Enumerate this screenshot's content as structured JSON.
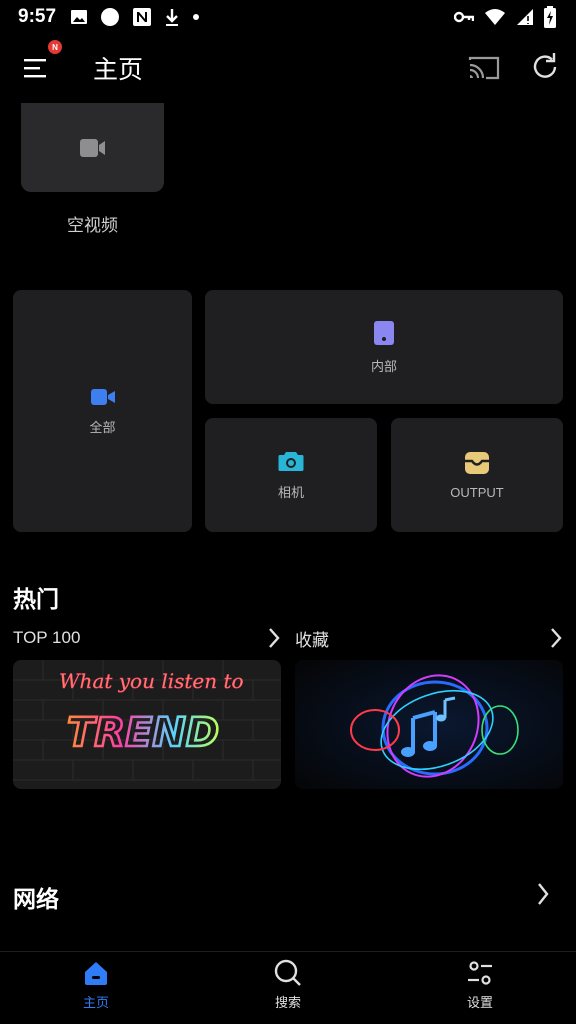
{
  "status_bar": {
    "time": "9:57",
    "left_icons": [
      "image-icon",
      "circle-icon",
      "news-icon",
      "download-icon",
      "dot-icon"
    ],
    "right_icons": [
      "key-icon",
      "wifi-icon",
      "signal-icon",
      "battery-charging-icon"
    ]
  },
  "app_bar": {
    "title": "主页",
    "menu_badge": "N",
    "actions": [
      "cast-icon",
      "refresh-icon"
    ]
  },
  "empty_video": {
    "label": "空视频"
  },
  "categories": {
    "all": "全部",
    "internal": "内部",
    "camera": "相机",
    "output": "OUTPUT"
  },
  "hot": {
    "title": "热门",
    "playlists": [
      {
        "label": "TOP 100"
      },
      {
        "label": "收藏"
      }
    ],
    "cover_text": {
      "top100_line1": "What you listen to",
      "top100_line2": "TREND"
    }
  },
  "network": {
    "title": "网络"
  },
  "bottom_nav": {
    "items": [
      {
        "label": "主页",
        "active": true
      },
      {
        "label": "搜索",
        "active": false
      },
      {
        "label": "设置",
        "active": false
      }
    ]
  },
  "colors": {
    "accent": "#2f7cf6",
    "all_icon": "#3d7ff0",
    "internal_icon": "#8b87f0",
    "camera_icon": "#29b6d6",
    "output_icon": "#e8c97a",
    "badge": "#e53935",
    "tile_bg": "#1f1f21"
  }
}
